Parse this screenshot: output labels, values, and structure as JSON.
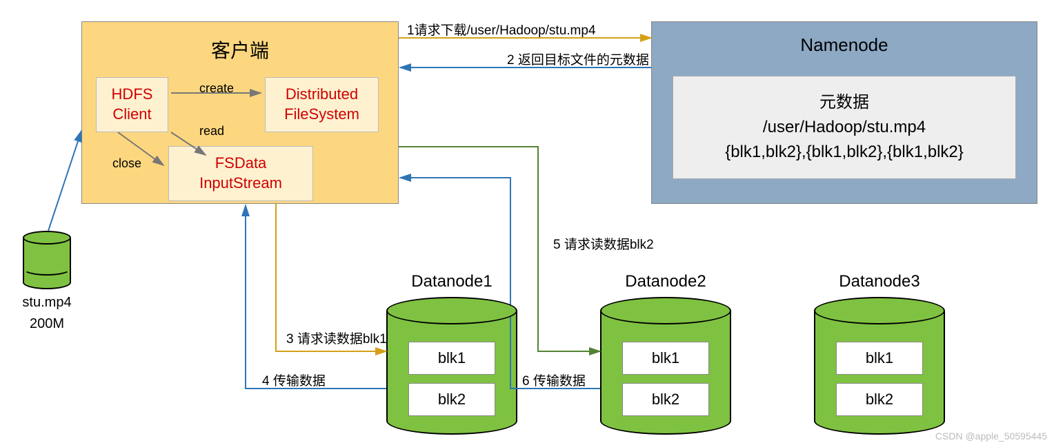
{
  "client": {
    "title": "客户端",
    "hdfs_client": "HDFS\nClient",
    "dist_fs": "Distributed\nFileSystem",
    "fsdata": "FSData\nInputStream",
    "create_label": "create",
    "read_label": "read",
    "close_label": "close"
  },
  "namenode": {
    "title": "Namenode",
    "meta_title": "元数据",
    "meta_path": "/user/Hadoop/stu.mp4",
    "meta_blocks": "{blk1,blk2},{blk1,blk2},{blk1,blk2}"
  },
  "file": {
    "name": "stu.mp4",
    "size": "200M"
  },
  "datanodes": {
    "dn1_title": "Datanode1",
    "dn2_title": "Datanode2",
    "dn3_title": "Datanode3",
    "blk1": "blk1",
    "blk2": "blk2"
  },
  "steps": {
    "s1": "1请求下载/user/Hadoop/stu.mp4",
    "s2": "2 返回目标文件的元数据",
    "s3": "3 请求读数据blk1",
    "s4": "4 传输数据",
    "s5": "5 请求读数据blk2",
    "s6": "6 传输数据"
  },
  "watermark": "CSDN @apple_50595445"
}
